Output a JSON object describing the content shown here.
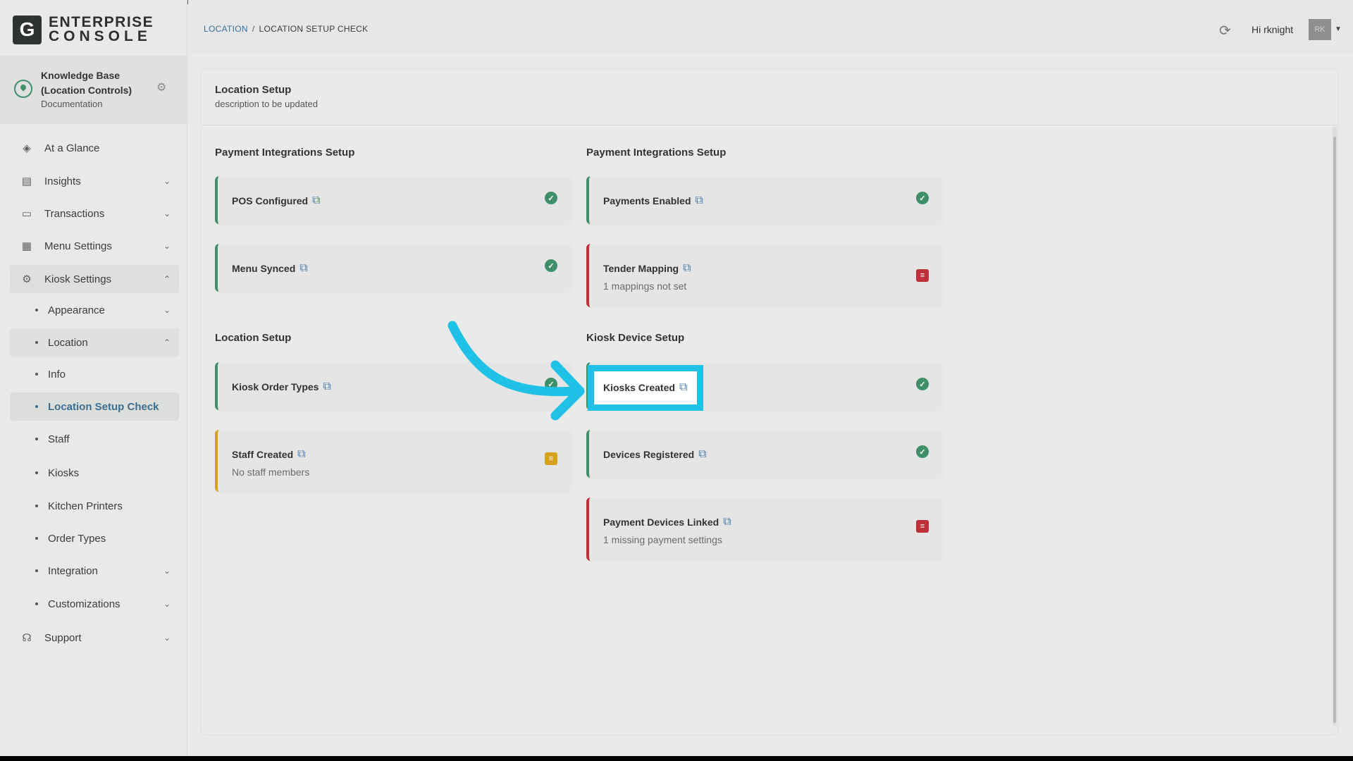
{
  "brand": {
    "logo": "G",
    "line1": "ENTERPRISE",
    "line2": "CONSOLE"
  },
  "account": {
    "name": "Knowledge Base (Location Controls)",
    "sub": "Documentation",
    "settings_icon": "gear-icon"
  },
  "nav": [
    {
      "label": "At a Glance",
      "icon": "layers-icon"
    },
    {
      "label": "Insights",
      "icon": "clipboard-icon"
    },
    {
      "label": "Transactions",
      "icon": "receipt-icon"
    },
    {
      "label": "Menu Settings",
      "icon": "menu-icon"
    },
    {
      "label": "Kiosk Settings",
      "icon": "gear-icon"
    }
  ],
  "kiosk_sub": [
    {
      "label": "Appearance"
    },
    {
      "label": "Location"
    },
    {
      "label": "Info"
    },
    {
      "label": "Location Setup Check"
    },
    {
      "label": "Staff"
    },
    {
      "label": "Kiosks"
    },
    {
      "label": "Kitchen Printers"
    },
    {
      "label": "Order Types"
    },
    {
      "label": "Integration"
    },
    {
      "label": "Customizations"
    }
  ],
  "support": {
    "label": "Support",
    "icon": "headset-icon"
  },
  "header": {
    "crumb_link": "LOCATION",
    "crumb_sep": "/",
    "crumb_current": "LOCATION SETUP CHECK",
    "greeting": "Hi rknight",
    "avatar": "RK"
  },
  "main": {
    "title": "Location Setup",
    "description": "description to be updated"
  },
  "sections": {
    "left_top": "Payment Integrations Setup",
    "right_top": "Payment Integrations Setup",
    "left_bottom": "Location Setup",
    "right_bottom": "Kiosk Device Setup"
  },
  "cards": {
    "pos": {
      "label": "POS Configured",
      "status": "ok"
    },
    "menu": {
      "label": "Menu Synced",
      "status": "ok"
    },
    "payments": {
      "label": "Payments Enabled",
      "status": "ok"
    },
    "tender": {
      "label": "Tender Mapping",
      "note": "1 mappings not set",
      "status": "error"
    },
    "order_types": {
      "label": "Kiosk Order Types",
      "status": "ok"
    },
    "staff": {
      "label": "Staff Created",
      "note": "No staff members",
      "status": "warning"
    },
    "kiosks": {
      "label": "Kiosks Created",
      "status": "ok"
    },
    "devices": {
      "label": "Devices Registered",
      "status": "ok"
    },
    "payment_devices": {
      "label": "Payment Devices Linked",
      "note": "1 missing payment settings",
      "status": "error"
    }
  },
  "colors": {
    "accent": "#1fc1e6",
    "ok": "#3f8f6b",
    "error": "#c0303a",
    "warning": "#d6a21b",
    "link": "#3b6e9a"
  }
}
